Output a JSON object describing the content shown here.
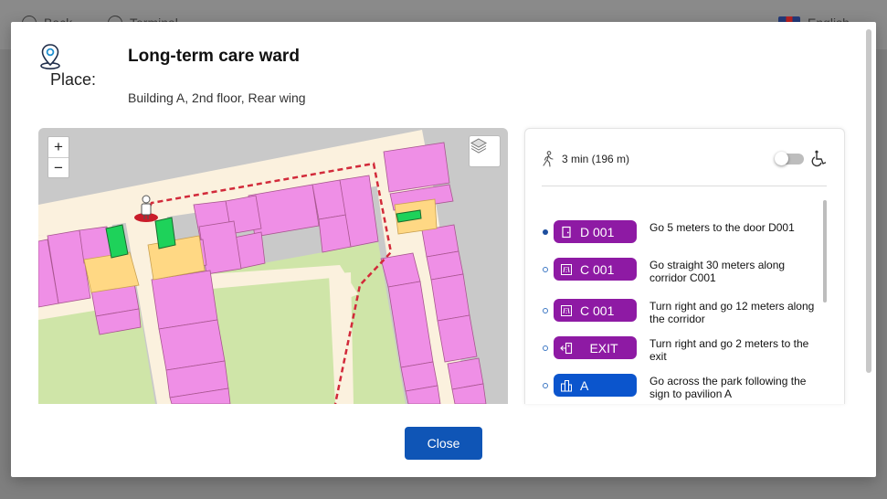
{
  "background": {
    "nav_items": [
      "Back",
      "Terminal"
    ],
    "language": "English"
  },
  "dialog": {
    "place_label": "Place:",
    "title": "Long-term care ward",
    "subtitle": "Building A, 2nd floor, Rear wing",
    "close_label": "Close"
  },
  "map": {
    "zoom_in": "+",
    "zoom_out": "−",
    "layers_icon": "layers-icon",
    "colors": {
      "room": "#ef8fe6",
      "corridor": "#fbf1de",
      "park": "#cfe5a8",
      "stairs": "#ffd884",
      "elevator": "#1ed25a",
      "route": "#d22a3a"
    }
  },
  "route": {
    "duration": "3 min (196 m)",
    "accessibility_toggle": "off",
    "steps": [
      {
        "badge": "D 001",
        "icon": "door-icon",
        "color": "#8e1aa4",
        "text": "Go 5 meters to the door D001",
        "active": true
      },
      {
        "badge": "C 001",
        "icon": "corridor-icon",
        "color": "#8e1aa4",
        "text": "Go straight 30 meters along corridor C001",
        "active": false
      },
      {
        "badge": "C 001",
        "icon": "corridor-icon",
        "color": "#8e1aa4",
        "text": "Turn right and go 12 meters along the corridor",
        "active": false
      },
      {
        "badge": "EXIT",
        "icon": "exit-icon",
        "color": "#8e1aa4",
        "text": "Turn right and go 2 meters to the exit",
        "active": false
      },
      {
        "badge": "A",
        "icon": "building-icon",
        "color": "#0b55cd",
        "text": "Go across the park following the sign to pavilion A",
        "active": false
      }
    ]
  }
}
